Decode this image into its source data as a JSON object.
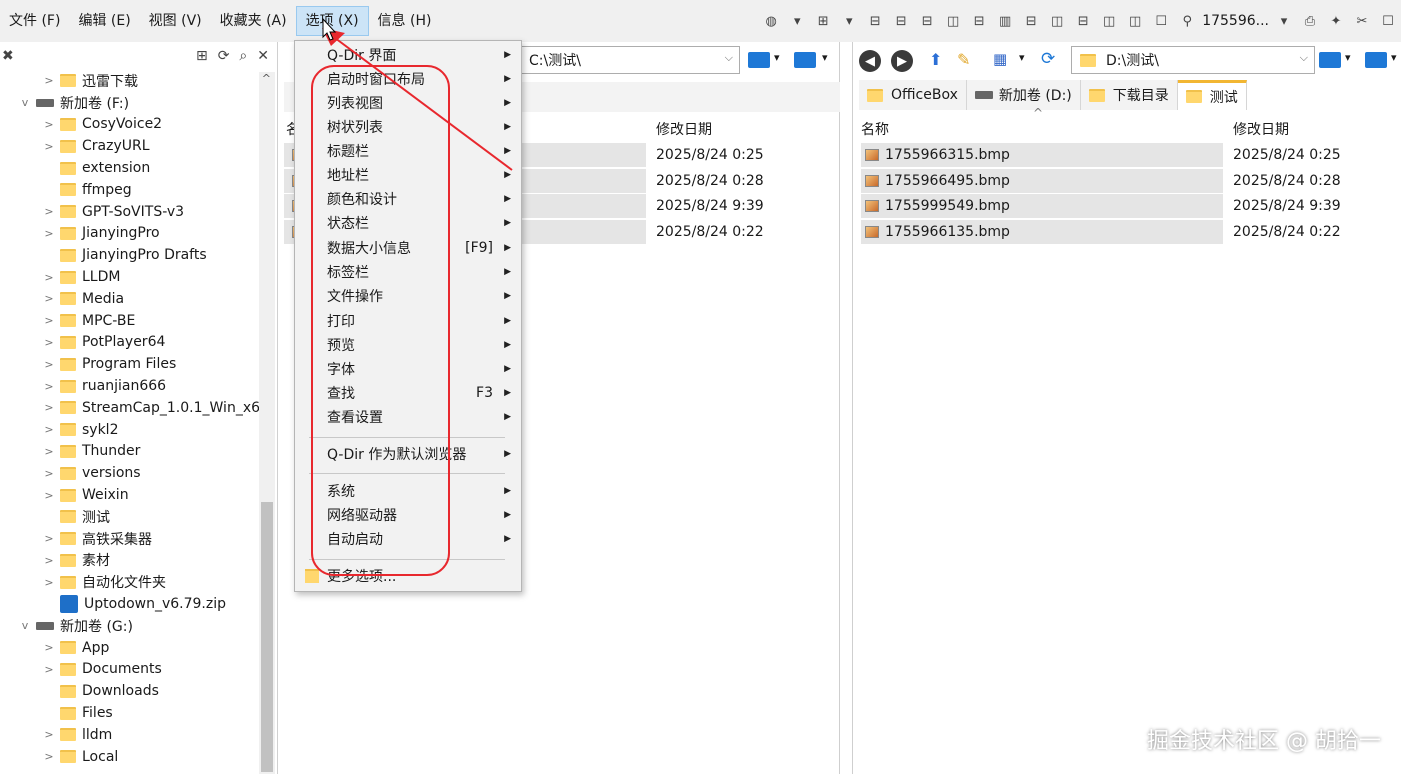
{
  "menubar": {
    "items": [
      "文件 (F)",
      "编辑 (E)",
      "视图 (V)",
      "收藏夹 (A)",
      "选项 (X)",
      "信息 (H)"
    ],
    "address_label": "175596..."
  },
  "tree": {
    "items": [
      {
        "label": "迅雷下载",
        "type": "folder",
        "level": 1,
        "exp": ">"
      },
      {
        "label": "新加卷 (F:)",
        "type": "drive",
        "level": 0,
        "exp": "v"
      },
      {
        "label": "CosyVoice2",
        "type": "folder",
        "level": 1,
        "exp": ">"
      },
      {
        "label": "CrazyURL",
        "type": "folder",
        "level": 1,
        "exp": ">"
      },
      {
        "label": "extension",
        "type": "folder",
        "level": 1,
        "exp": ""
      },
      {
        "label": "ffmpeg",
        "type": "folder",
        "level": 1,
        "exp": ""
      },
      {
        "label": "GPT-SoVITS-v3",
        "type": "folder",
        "level": 1,
        "exp": ">"
      },
      {
        "label": "JianyingPro",
        "type": "folder",
        "level": 1,
        "exp": ">"
      },
      {
        "label": "JianyingPro Drafts",
        "type": "folder",
        "level": 1,
        "exp": ""
      },
      {
        "label": "LLDM",
        "type": "folder",
        "level": 1,
        "exp": ">"
      },
      {
        "label": "Media",
        "type": "folder",
        "level": 1,
        "exp": ">"
      },
      {
        "label": "MPC-BE",
        "type": "folder",
        "level": 1,
        "exp": ">"
      },
      {
        "label": "PotPlayer64",
        "type": "folder",
        "level": 1,
        "exp": ">"
      },
      {
        "label": "Program Files",
        "type": "folder",
        "level": 1,
        "exp": ">"
      },
      {
        "label": "ruanjian666",
        "type": "folder",
        "level": 1,
        "exp": ">"
      },
      {
        "label": "StreamCap_1.0.1_Win_x6",
        "type": "folder",
        "level": 1,
        "exp": ">"
      },
      {
        "label": "sykl2",
        "type": "folder",
        "level": 1,
        "exp": ">"
      },
      {
        "label": "Thunder",
        "type": "folder",
        "level": 1,
        "exp": ">"
      },
      {
        "label": "versions",
        "type": "folder",
        "level": 1,
        "exp": ">"
      },
      {
        "label": "Weixin",
        "type": "folder",
        "level": 1,
        "exp": ">"
      },
      {
        "label": "测试",
        "type": "folder",
        "level": 1,
        "exp": ""
      },
      {
        "label": "高铁采集器",
        "type": "folder",
        "level": 1,
        "exp": ">"
      },
      {
        "label": "素材",
        "type": "folder",
        "level": 1,
        "exp": ">"
      },
      {
        "label": "自动化文件夹",
        "type": "folder",
        "level": 1,
        "exp": ">"
      },
      {
        "label": "Uptodown_v6.79.zip",
        "type": "zip",
        "level": 1,
        "exp": ""
      },
      {
        "label": "新加卷 (G:)",
        "type": "drive",
        "level": 0,
        "exp": "v"
      },
      {
        "label": "App",
        "type": "folder",
        "level": 1,
        "exp": ">"
      },
      {
        "label": "Documents",
        "type": "folder",
        "level": 1,
        "exp": ">"
      },
      {
        "label": "Downloads",
        "type": "folder",
        "level": 1,
        "exp": ""
      },
      {
        "label": "Files",
        "type": "folder",
        "level": 1,
        "exp": ""
      },
      {
        "label": "lldm",
        "type": "folder",
        "level": 1,
        "exp": ">"
      },
      {
        "label": "Local",
        "type": "folder",
        "level": 1,
        "exp": ">"
      }
    ]
  },
  "left_pane": {
    "address": "C:\\测试\\",
    "col_name": "名",
    "col_date": "修改日期",
    "dates": [
      "2025/8/24 0:25",
      "2025/8/24 0:28",
      "2025/8/24 9:39",
      "2025/8/24 0:22"
    ]
  },
  "right_pane": {
    "address": "D:\\测试\\",
    "tabs": [
      {
        "label": "OfficeBox",
        "icon": "folder"
      },
      {
        "label": "新加卷 (D:)",
        "icon": "drive"
      },
      {
        "label": "下载目录",
        "icon": "folder"
      },
      {
        "label": "测试",
        "icon": "folder",
        "active": true
      }
    ],
    "col_name": "名称",
    "col_date": "修改日期",
    "files": [
      {
        "name": "1755966315.bmp",
        "date": "2025/8/24 0:25"
      },
      {
        "name": "1755966495.bmp",
        "date": "2025/8/24 0:28"
      },
      {
        "name": "1755999549.bmp",
        "date": "2025/8/24 9:39"
      },
      {
        "name": "1755966135.bmp",
        "date": "2025/8/24 0:22"
      }
    ]
  },
  "options_menu": {
    "items": [
      {
        "label": "Q-Dir 界面",
        "shortcut": "",
        "arrow": true
      },
      {
        "label": "启动时窗口布局",
        "shortcut": "",
        "arrow": true
      },
      {
        "label": "列表视图",
        "shortcut": "",
        "arrow": true
      },
      {
        "label": "树状列表",
        "shortcut": "",
        "arrow": true
      },
      {
        "label": "标题栏",
        "shortcut": "",
        "arrow": true
      },
      {
        "label": "地址栏",
        "shortcut": "",
        "arrow": true
      },
      {
        "label": "颜色和设计",
        "shortcut": "",
        "arrow": true
      },
      {
        "label": "状态栏",
        "shortcut": "",
        "arrow": true
      },
      {
        "label": "数据大小信息",
        "shortcut": "[F9]",
        "arrow": true
      },
      {
        "label": "标签栏",
        "shortcut": "",
        "arrow": true
      },
      {
        "label": "文件操作",
        "shortcut": "",
        "arrow": true
      },
      {
        "label": "打印",
        "shortcut": "",
        "arrow": true
      },
      {
        "label": "预览",
        "shortcut": "",
        "arrow": true
      },
      {
        "label": "字体",
        "shortcut": "",
        "arrow": true
      },
      {
        "label": "查找",
        "shortcut": "F3",
        "arrow": true
      },
      {
        "label": "查看设置",
        "shortcut": "",
        "arrow": true
      },
      {
        "label": "Q-Dir 作为默认浏览器",
        "shortcut": "",
        "arrow": true
      },
      {
        "label": "系统",
        "shortcut": "",
        "arrow": true
      },
      {
        "label": "网络驱动器",
        "shortcut": "",
        "arrow": true
      },
      {
        "label": "自动启动",
        "shortcut": "",
        "arrow": true
      },
      {
        "label": "更多选项...",
        "shortcut": "",
        "arrow": false
      }
    ]
  },
  "watermark": "掘金技术社区 @ 胡拾一",
  "colors": {
    "accent": "#1e78d6",
    "folder": "#ffd76e",
    "annotation": "#e8282e",
    "menu_active": "#cce4f7"
  }
}
